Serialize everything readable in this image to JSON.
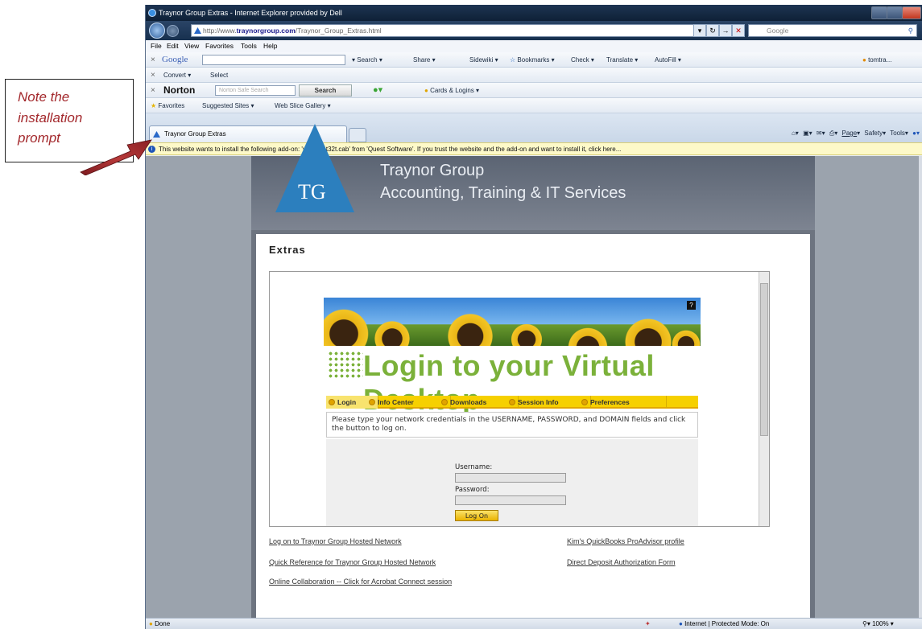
{
  "annotation": {
    "lines": [
      "Note the",
      "installation",
      "prompt"
    ]
  },
  "window": {
    "title": "Traynor Group Extras - Internet Explorer provided by Dell"
  },
  "address_bar": {
    "url_prefix": "http://www.",
    "url_domain": "traynorgroup.com",
    "url_path": "/Traynor_Group_Extras.html",
    "search_placeholder": "Google"
  },
  "menu": [
    "File",
    "Edit",
    "View",
    "Favorites",
    "Tools",
    "Help"
  ],
  "google_toolbar": {
    "brand": "Google",
    "items": [
      "Search",
      "Share",
      "Sidewiki",
      "Bookmarks",
      "Check",
      "Translate",
      "AutoFill"
    ],
    "user": "tomtra..."
  },
  "convert_toolbar": {
    "items": [
      "Convert",
      "Select"
    ]
  },
  "norton_toolbar": {
    "brand": "Norton",
    "search_placeholder": "Norton Safe Search",
    "search_button": "Search",
    "cards_logins": "Cards & Logins"
  },
  "favorites_bar": {
    "items": [
      "Favorites",
      "Suggested Sites",
      "Web Slice Gallery"
    ]
  },
  "tab": {
    "title": "Traynor Group Extras"
  },
  "command_bar": {
    "items": [
      "Page",
      "Safety",
      "Tools"
    ]
  },
  "info_bar": {
    "message": "This website wants to install the following add-on: 'vasclient32t.cab' from 'Quest Software'. If you trust the website and the add-on and want to install it, click here..."
  },
  "site": {
    "logo": "TG",
    "title_line1": "Traynor Group",
    "title_line2": "Accounting, Training & IT Services",
    "section_heading": "Extras",
    "login_heading": "Login to your Virtual Desktop",
    "login_tabs": [
      "Login",
      "Info Center",
      "Downloads",
      "Session Info",
      "Preferences"
    ],
    "instructions": "Please type your network credentials in the USERNAME, PASSWORD, and DOMAIN fields and click the button to log on.",
    "username_label": "Username:",
    "password_label": "Password:",
    "logon_button": "Log On",
    "links_left": [
      "Log on to Traynor Group Hosted Network",
      "Quick Reference for Traynor Group Hosted Network",
      "Online Collaboration -- Click for Acrobat Connect session"
    ],
    "links_right": [
      "Kim's QuickBooks ProAdvisor profile",
      "Direct Deposit Authorization Form"
    ]
  },
  "status_bar": {
    "left": "Done",
    "zone": "Internet | Protected Mode: On",
    "zoom": "100%"
  },
  "colors": {
    "annotation": "#a3282c",
    "login_green": "#7bb13a",
    "login_tab_yellow": "#f6d000",
    "info_bar": "#fdf9c8"
  }
}
